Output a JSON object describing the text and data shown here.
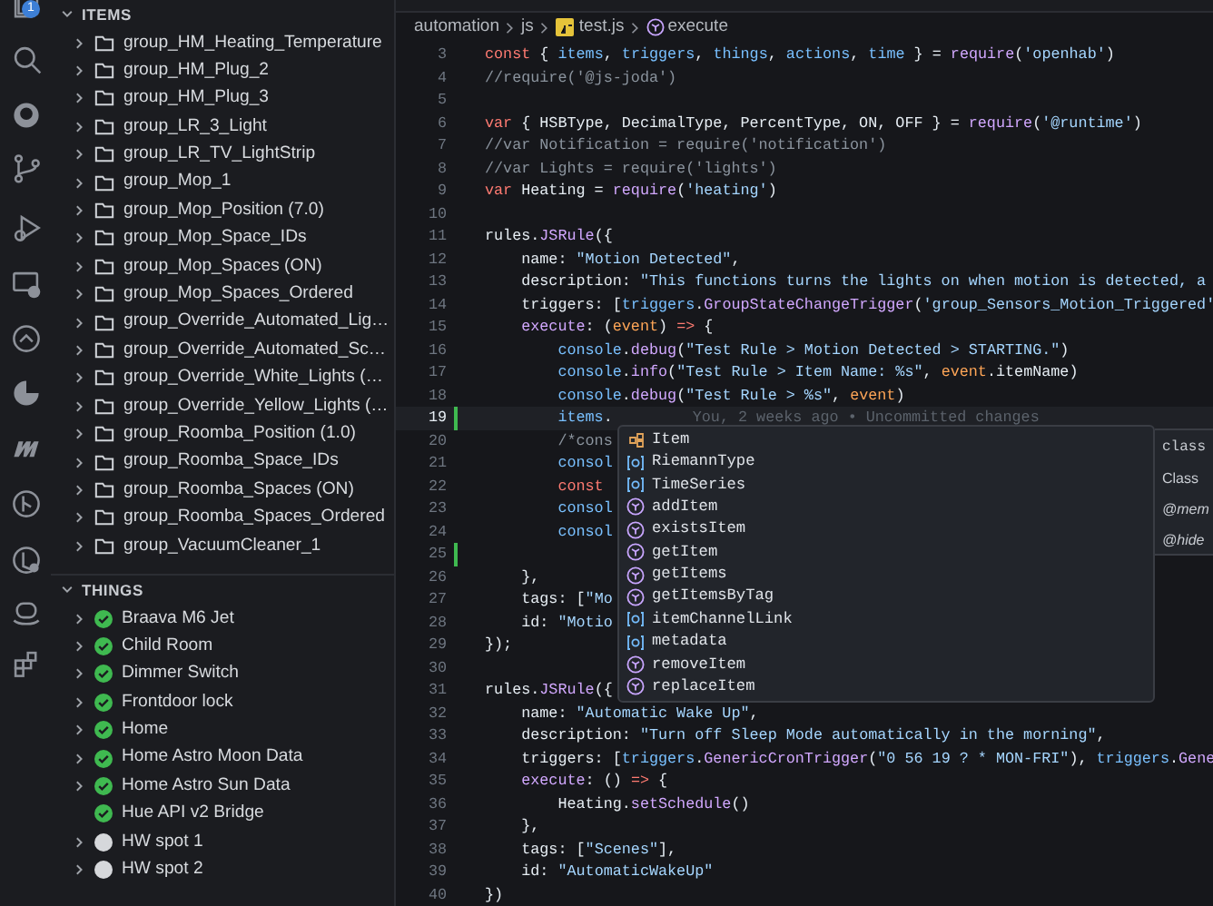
{
  "activity_bar": {
    "badge": "1"
  },
  "sidebar": {
    "sections": [
      {
        "title": "ITEMS",
        "expanded": true,
        "items": [
          {
            "label": "group_HM_Heating_Temperature"
          },
          {
            "label": "group_HM_Plug_2"
          },
          {
            "label": "group_HM_Plug_3"
          },
          {
            "label": "group_LR_3_Light"
          },
          {
            "label": "group_LR_TV_LightStrip"
          },
          {
            "label": "group_Mop_1"
          },
          {
            "label": "group_Mop_Position (7.0)"
          },
          {
            "label": "group_Mop_Space_IDs"
          },
          {
            "label": "group_Mop_Spaces (ON)"
          },
          {
            "label": "group_Mop_Spaces_Ordered"
          },
          {
            "label": "group_Override_Automated_Lig…"
          },
          {
            "label": "group_Override_Automated_Sc…"
          },
          {
            "label": "group_Override_White_Lights (…"
          },
          {
            "label": "group_Override_Yellow_Lights (…"
          },
          {
            "label": "group_Roomba_Position (1.0)"
          },
          {
            "label": "group_Roomba_Space_IDs"
          },
          {
            "label": "group_Roomba_Spaces (ON)"
          },
          {
            "label": "group_Roomba_Spaces_Ordered"
          },
          {
            "label": "group_VacuumCleaner_1"
          }
        ]
      },
      {
        "title": "THINGS",
        "expanded": true,
        "things": [
          {
            "label": "Braava M6 Jet",
            "online": true,
            "expandable": true
          },
          {
            "label": "Child Room",
            "online": true,
            "expandable": true
          },
          {
            "label": "Dimmer Switch",
            "online": true,
            "expandable": true
          },
          {
            "label": "Frontdoor lock",
            "online": true,
            "expandable": true
          },
          {
            "label": "Home",
            "online": true,
            "expandable": true
          },
          {
            "label": "Home Astro Moon Data",
            "online": true,
            "expandable": true
          },
          {
            "label": "Home Astro Sun Data",
            "online": true,
            "expandable": true
          },
          {
            "label": "Hue API v2 Bridge",
            "online": true,
            "expandable": false
          },
          {
            "label": "HW spot 1",
            "online": false,
            "expandable": true
          },
          {
            "label": "HW spot 2",
            "online": false,
            "expandable": true
          }
        ]
      }
    ]
  },
  "breadcrumb": [
    {
      "label": "automation",
      "kind": "folder"
    },
    {
      "label": "js",
      "kind": "folder"
    },
    {
      "label": "test.js",
      "kind": "file"
    },
    {
      "label": "execute",
      "kind": "symbol"
    }
  ],
  "editor": {
    "lines": [
      {
        "number": "3",
        "modified": false,
        "current": false,
        "segments": [
          {
            "text": "const",
            "kind": "keyword"
          },
          {
            "text": " { ",
            "kind": "plain"
          },
          {
            "text": "items",
            "kind": "variable"
          },
          {
            "text": ", ",
            "kind": "plain"
          },
          {
            "text": "triggers",
            "kind": "variable"
          },
          {
            "text": ", ",
            "kind": "plain"
          },
          {
            "text": "things",
            "kind": "variable"
          },
          {
            "text": ", ",
            "kind": "plain"
          },
          {
            "text": "actions",
            "kind": "variable"
          },
          {
            "text": ", ",
            "kind": "plain"
          },
          {
            "text": "time",
            "kind": "variable"
          },
          {
            "text": " } = ",
            "kind": "plain"
          },
          {
            "text": "require",
            "kind": "function"
          },
          {
            "text": "(",
            "kind": "plain"
          },
          {
            "text": "'openhab'",
            "kind": "string"
          },
          {
            "text": ")",
            "kind": "plain"
          }
        ]
      },
      {
        "number": "4",
        "modified": false,
        "current": false,
        "segments": [
          {
            "text": "//require('@js-joda')",
            "kind": "comment"
          }
        ]
      },
      {
        "number": "5",
        "modified": false,
        "current": false
      },
      {
        "number": "6",
        "modified": false,
        "current": false,
        "segments": [
          {
            "text": "var",
            "kind": "keyword"
          },
          {
            "text": " { HSBType, DecimalType, PercentType, ON, OFF } = ",
            "kind": "plain"
          },
          {
            "text": "require",
            "kind": "function"
          },
          {
            "text": "(",
            "kind": "plain"
          },
          {
            "text": "'@runtime'",
            "kind": "string"
          },
          {
            "text": ")",
            "kind": "plain"
          }
        ]
      },
      {
        "number": "7",
        "modified": false,
        "current": false,
        "segments": [
          {
            "text": "//var Notification = require('notification')",
            "kind": "comment"
          }
        ]
      },
      {
        "number": "8",
        "modified": false,
        "current": false,
        "segments": [
          {
            "text": "//var Lights = require('lights')",
            "kind": "comment"
          }
        ]
      },
      {
        "number": "9",
        "modified": false,
        "current": false,
        "segments": [
          {
            "text": "var",
            "kind": "keyword"
          },
          {
            "text": " Heating = ",
            "kind": "plain"
          },
          {
            "text": "require",
            "kind": "function"
          },
          {
            "text": "(",
            "kind": "plain"
          },
          {
            "text": "'heating'",
            "kind": "string"
          },
          {
            "text": ")",
            "kind": "plain"
          }
        ]
      },
      {
        "number": "10",
        "modified": false,
        "current": false
      },
      {
        "number": "11",
        "modified": false,
        "current": false,
        "segments": [
          {
            "text": "rules.",
            "kind": "plain"
          },
          {
            "text": "JSRule",
            "kind": "function"
          },
          {
            "text": "({",
            "kind": "plain"
          }
        ]
      },
      {
        "number": "12",
        "modified": false,
        "current": false,
        "segments": [
          {
            "text": "    name: ",
            "kind": "plain"
          },
          {
            "text": "\"Motion Detected\"",
            "kind": "string"
          },
          {
            "text": ",",
            "kind": "plain"
          }
        ]
      },
      {
        "number": "13",
        "modified": false,
        "current": false,
        "segments": [
          {
            "text": "    description: ",
            "kind": "plain"
          },
          {
            "text": "\"This functions turns the lights on when motion is detected, a",
            "kind": "string"
          }
        ]
      },
      {
        "number": "14",
        "modified": false,
        "current": false,
        "segments": [
          {
            "text": "    triggers: [",
            "kind": "plain"
          },
          {
            "text": "triggers",
            "kind": "variable"
          },
          {
            "text": ".",
            "kind": "plain"
          },
          {
            "text": "GroupStateChangeTrigger",
            "kind": "function"
          },
          {
            "text": "(",
            "kind": "plain"
          },
          {
            "text": "'group_Sensors_Motion_Triggered'",
            "kind": "string"
          }
        ]
      },
      {
        "number": "15",
        "modified": false,
        "current": false,
        "segments": [
          {
            "text": "    execute",
            "kind": "function"
          },
          {
            "text": ": (",
            "kind": "plain"
          },
          {
            "text": "event",
            "kind": "parameter"
          },
          {
            "text": ") ",
            "kind": "plain"
          },
          {
            "text": "=>",
            "kind": "keyword"
          },
          {
            "text": " {",
            "kind": "plain"
          }
        ]
      },
      {
        "number": "16",
        "modified": false,
        "current": false,
        "segments": [
          {
            "text": "        console",
            "kind": "variable"
          },
          {
            "text": ".",
            "kind": "plain"
          },
          {
            "text": "debug",
            "kind": "function"
          },
          {
            "text": "(",
            "kind": "plain"
          },
          {
            "text": "\"Test Rule > Motion Detected > STARTING.\"",
            "kind": "string"
          },
          {
            "text": ")",
            "kind": "plain"
          }
        ]
      },
      {
        "number": "17",
        "modified": false,
        "current": false,
        "segments": [
          {
            "text": "        console",
            "kind": "variable"
          },
          {
            "text": ".",
            "kind": "plain"
          },
          {
            "text": "info",
            "kind": "function"
          },
          {
            "text": "(",
            "kind": "plain"
          },
          {
            "text": "\"Test Rule > Item Name: %s\"",
            "kind": "string"
          },
          {
            "text": ", ",
            "kind": "plain"
          },
          {
            "text": "event",
            "kind": "parameter"
          },
          {
            "text": ".itemName)",
            "kind": "plain"
          }
        ]
      },
      {
        "number": "18",
        "modified": false,
        "current": false,
        "segments": [
          {
            "text": "        console",
            "kind": "variable"
          },
          {
            "text": ".",
            "kind": "plain"
          },
          {
            "text": "debug",
            "kind": "function"
          },
          {
            "text": "(",
            "kind": "plain"
          },
          {
            "text": "\"Test Rule > %s\"",
            "kind": "string"
          },
          {
            "text": ", ",
            "kind": "plain"
          },
          {
            "text": "event",
            "kind": "parameter"
          },
          {
            "text": ")",
            "kind": "plain"
          }
        ]
      },
      {
        "number": "19",
        "modified": true,
        "current": true,
        "segments": [
          {
            "text": "        items",
            "kind": "variable"
          },
          {
            "text": ".",
            "kind": "plain"
          }
        ],
        "blame": "You, 2 weeks ago • Uncommitted changes"
      },
      {
        "number": "20",
        "modified": false,
        "current": false,
        "segments": [
          {
            "text": "        /*cons",
            "kind": "comment"
          }
        ]
      },
      {
        "number": "21",
        "modified": false,
        "current": false,
        "segments": [
          {
            "text": "        consol",
            "kind": "variable"
          }
        ]
      },
      {
        "number": "22",
        "modified": false,
        "current": false,
        "segments": [
          {
            "text": "        const",
            "kind": "keyword"
          }
        ]
      },
      {
        "number": "23",
        "modified": false,
        "current": false,
        "segments": [
          {
            "text": "        consol",
            "kind": "variable"
          }
        ]
      },
      {
        "number": "24",
        "modified": false,
        "current": false,
        "segments": [
          {
            "text": "        consol",
            "kind": "variable"
          }
        ]
      },
      {
        "number": "25",
        "modified": true,
        "current": false
      },
      {
        "number": "26",
        "modified": false,
        "current": false,
        "segments": [
          {
            "text": "    },",
            "kind": "plain"
          }
        ]
      },
      {
        "number": "27",
        "modified": false,
        "current": false,
        "segments": [
          {
            "text": "    tags: [",
            "kind": "plain"
          },
          {
            "text": "\"Mo",
            "kind": "string"
          }
        ]
      },
      {
        "number": "28",
        "modified": false,
        "current": false,
        "segments": [
          {
            "text": "    id: ",
            "kind": "plain"
          },
          {
            "text": "\"Motio",
            "kind": "string"
          }
        ]
      },
      {
        "number": "29",
        "modified": false,
        "current": false,
        "segments": [
          {
            "text": "});",
            "kind": "plain"
          }
        ]
      },
      {
        "number": "30",
        "modified": false,
        "current": false
      },
      {
        "number": "31",
        "modified": false,
        "current": false,
        "segments": [
          {
            "text": "rules.",
            "kind": "plain"
          },
          {
            "text": "JSRule",
            "kind": "function"
          },
          {
            "text": "({",
            "kind": "plain"
          }
        ]
      },
      {
        "number": "32",
        "modified": false,
        "current": false,
        "segments": [
          {
            "text": "    name: ",
            "kind": "plain"
          },
          {
            "text": "\"Automatic Wake Up\"",
            "kind": "string"
          },
          {
            "text": ",",
            "kind": "plain"
          }
        ]
      },
      {
        "number": "33",
        "modified": false,
        "current": false,
        "segments": [
          {
            "text": "    description: ",
            "kind": "plain"
          },
          {
            "text": "\"Turn off Sleep Mode automatically in the morning\"",
            "kind": "string"
          },
          {
            "text": ",",
            "kind": "plain"
          }
        ]
      },
      {
        "number": "34",
        "modified": false,
        "current": false,
        "segments": [
          {
            "text": "    triggers: [",
            "kind": "plain"
          },
          {
            "text": "triggers",
            "kind": "variable"
          },
          {
            "text": ".",
            "kind": "plain"
          },
          {
            "text": "GenericCronTrigger",
            "kind": "function"
          },
          {
            "text": "(",
            "kind": "plain"
          },
          {
            "text": "\"0 56 19 ? * MON-FRI\"",
            "kind": "string"
          },
          {
            "text": "), ",
            "kind": "plain"
          },
          {
            "text": "triggers",
            "kind": "variable"
          },
          {
            "text": ".",
            "kind": "plain"
          },
          {
            "text": "Gene",
            "kind": "function"
          }
        ]
      },
      {
        "number": "35",
        "modified": false,
        "current": false,
        "segments": [
          {
            "text": "    execute",
            "kind": "function"
          },
          {
            "text": ": () ",
            "kind": "plain"
          },
          {
            "text": "=>",
            "kind": "keyword"
          },
          {
            "text": " {",
            "kind": "plain"
          }
        ]
      },
      {
        "number": "36",
        "modified": false,
        "current": false,
        "segments": [
          {
            "text": "        Heating.",
            "kind": "plain"
          },
          {
            "text": "setSchedule",
            "kind": "function"
          },
          {
            "text": "()",
            "kind": "plain"
          }
        ]
      },
      {
        "number": "37",
        "modified": false,
        "current": false,
        "segments": [
          {
            "text": "    },",
            "kind": "plain"
          }
        ]
      },
      {
        "number": "38",
        "modified": false,
        "current": false,
        "segments": [
          {
            "text": "    tags: [",
            "kind": "plain"
          },
          {
            "text": "\"Scenes\"",
            "kind": "string"
          },
          {
            "text": "],",
            "kind": "plain"
          }
        ]
      },
      {
        "number": "39",
        "modified": false,
        "current": false,
        "segments": [
          {
            "text": "    id: ",
            "kind": "plain"
          },
          {
            "text": "\"AutomaticWakeUp\"",
            "kind": "string"
          }
        ]
      },
      {
        "number": "40",
        "modified": false,
        "current": false,
        "segments": [
          {
            "text": "})",
            "kind": "plain"
          }
        ]
      }
    ]
  },
  "suggestions": {
    "items": [
      {
        "label": "Item",
        "kind": "class"
      },
      {
        "label": "RiemannType",
        "kind": "variable"
      },
      {
        "label": "TimeSeries",
        "kind": "variable"
      },
      {
        "label": "addItem",
        "kind": "method"
      },
      {
        "label": "existsItem",
        "kind": "method"
      },
      {
        "label": "getItem",
        "kind": "method"
      },
      {
        "label": "getItems",
        "kind": "method"
      },
      {
        "label": "getItemsByTag",
        "kind": "method"
      },
      {
        "label": "itemChannelLink",
        "kind": "variable"
      },
      {
        "label": "metadata",
        "kind": "variable"
      },
      {
        "label": "removeItem",
        "kind": "method"
      },
      {
        "label": "replaceItem",
        "kind": "method"
      }
    ],
    "details": [
      {
        "text": "class",
        "kind": "code"
      },
      {
        "text": "Class",
        "kind": "plain"
      },
      {
        "text": "@mem",
        "kind": "tag"
      },
      {
        "text": "@hide",
        "kind": "tag"
      }
    ]
  }
}
